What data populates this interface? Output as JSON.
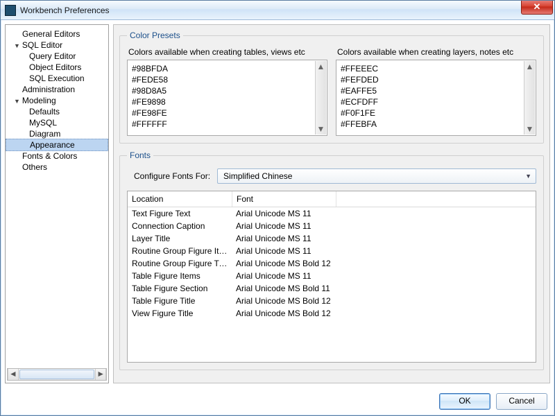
{
  "window": {
    "title": "Workbench Preferences"
  },
  "tree": {
    "general_editors": "General Editors",
    "sql_editor": "SQL Editor",
    "query_editor": "Query Editor",
    "object_editors": "Object Editors",
    "sql_execution": "SQL Execution",
    "administration": "Administration",
    "modeling": "Modeling",
    "defaults": "Defaults",
    "mysql": "MySQL",
    "diagram": "Diagram",
    "appearance": "Appearance",
    "fonts_colors": "Fonts & Colors",
    "others": "Others"
  },
  "color_presets": {
    "legend": "Color Presets",
    "tables_label": "Colors available when creating tables, views etc",
    "layers_label": "Colors available when creating layers, notes etc",
    "tables": [
      "#98BFDA",
      "#FEDE58",
      "#98D8A5",
      "#FE9898",
      "#FE98FE",
      "#FFFFFF"
    ],
    "layers": [
      "#FFEEEC",
      "#FEFDED",
      "#EAFFE5",
      "#ECFDFF",
      "#F0F1FE",
      "#FFEBFA"
    ]
  },
  "fonts": {
    "legend": "Fonts",
    "configure_label": "Configure Fonts For:",
    "configure_value": "Simplified Chinese",
    "col_location": "Location",
    "col_font": "Font",
    "rows": [
      {
        "loc": "Text Figure Text",
        "font": "Arial Unicode MS 11"
      },
      {
        "loc": "Connection Caption",
        "font": "Arial Unicode MS 11"
      },
      {
        "loc": "Layer Title",
        "font": "Arial Unicode MS 11"
      },
      {
        "loc": "Routine Group Figure Ite...",
        "font": "Arial Unicode MS 11"
      },
      {
        "loc": "Routine Group Figure Title",
        "font": "Arial Unicode MS Bold 12"
      },
      {
        "loc": "Table Figure Items",
        "font": "Arial Unicode MS 11"
      },
      {
        "loc": "Table Figure Section",
        "font": "Arial Unicode MS Bold 11"
      },
      {
        "loc": "Table Figure Title",
        "font": "Arial Unicode MS Bold 12"
      },
      {
        "loc": "View Figure Title",
        "font": "Arial Unicode MS Bold 12"
      }
    ]
  },
  "buttons": {
    "ok": "OK",
    "cancel": "Cancel"
  }
}
